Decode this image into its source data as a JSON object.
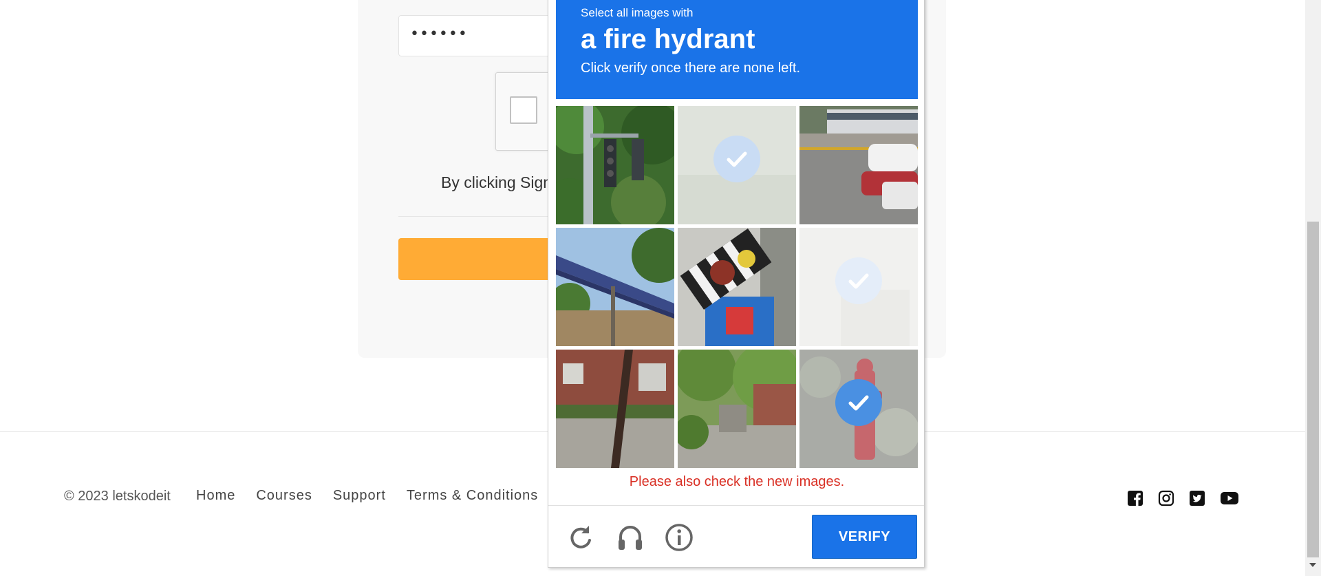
{
  "signup": {
    "password_value": "••••••",
    "terms_text": "By clicking Sign"
  },
  "footer": {
    "copyright": "© 2023 letskodeit",
    "links": [
      "Home",
      "Courses",
      "Support",
      "Terms & Conditions"
    ],
    "social_icons": [
      "facebook-icon",
      "instagram-icon",
      "twitter-icon",
      "youtube-icon"
    ]
  },
  "challenge": {
    "instruction_small": "Select all images with",
    "target": "a fire hydrant",
    "instruction_sub": "Click verify once there are none left.",
    "error": "Please also check the new images.",
    "verify_label": "VERIFY",
    "controls": [
      "reload-icon",
      "audio-challenge-icon",
      "info-icon"
    ],
    "tiles": [
      {
        "content": "traffic light",
        "state": "unselected"
      },
      {
        "content": "blank",
        "state": "selected-fading"
      },
      {
        "content": "street with cars",
        "state": "unselected"
      },
      {
        "content": "bridge",
        "state": "unselected"
      },
      {
        "content": "traffic light",
        "state": "unselected"
      },
      {
        "content": "blank",
        "state": "selected-fading"
      },
      {
        "content": "building with pole",
        "state": "unselected"
      },
      {
        "content": "trees and stairs",
        "state": "unselected"
      },
      {
        "content": "fire hydrant",
        "state": "selected"
      }
    ]
  },
  "colors": {
    "header_blue": "#1a73e8",
    "error_red": "#d93025",
    "signup_orange": "#ffab35",
    "check_blue": "#4a90e2"
  }
}
